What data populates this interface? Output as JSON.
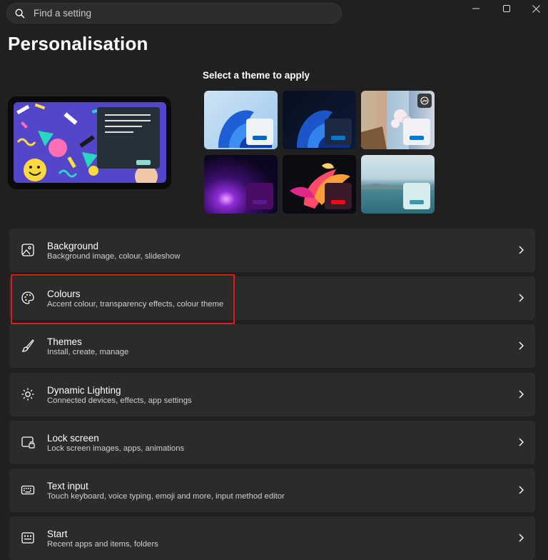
{
  "search": {
    "placeholder": "Find a setting"
  },
  "window_controls": [
    "minimize-icon",
    "maximize-icon",
    "close-icon"
  ],
  "page_title": "Personalisation",
  "themes": {
    "heading": "Select a theme to apply",
    "items": [
      {
        "name": "windows-light",
        "accent": "#0067c0"
      },
      {
        "name": "windows-dark",
        "accent": "#0078d4"
      },
      {
        "name": "glow-flower",
        "accent": "#0078d4"
      },
      {
        "name": "purple-glow",
        "accent": "#4b1a8a"
      },
      {
        "name": "captured-motion",
        "accent": "#e3101a"
      },
      {
        "name": "lake-flow",
        "accent": "#3a9aab"
      }
    ]
  },
  "settings": [
    {
      "id": "background",
      "title": "Background",
      "subtitle": "Background image, colour, slideshow",
      "icon": "image-icon"
    },
    {
      "id": "colours",
      "title": "Colours",
      "subtitle": "Accent colour, transparency effects, colour theme",
      "icon": "palette-icon"
    },
    {
      "id": "themes",
      "title": "Themes",
      "subtitle": "Install, create, manage",
      "icon": "brush-icon"
    },
    {
      "id": "dynamic-lighting",
      "title": "Dynamic Lighting",
      "subtitle": "Connected devices, effects, app settings",
      "icon": "lighting-icon"
    },
    {
      "id": "lock-screen",
      "title": "Lock screen",
      "subtitle": "Lock screen images, apps, animations",
      "icon": "lock-screen-icon"
    },
    {
      "id": "text-input",
      "title": "Text input",
      "subtitle": "Touch keyboard, voice typing, emoji and more, input method editor",
      "icon": "keyboard-icon"
    },
    {
      "id": "start",
      "title": "Start",
      "subtitle": "Recent apps and items, folders",
      "icon": "start-icon"
    }
  ],
  "colors": {
    "highlight": "#e0191e",
    "background": "#202020",
    "card": "#2b2b2b"
  }
}
